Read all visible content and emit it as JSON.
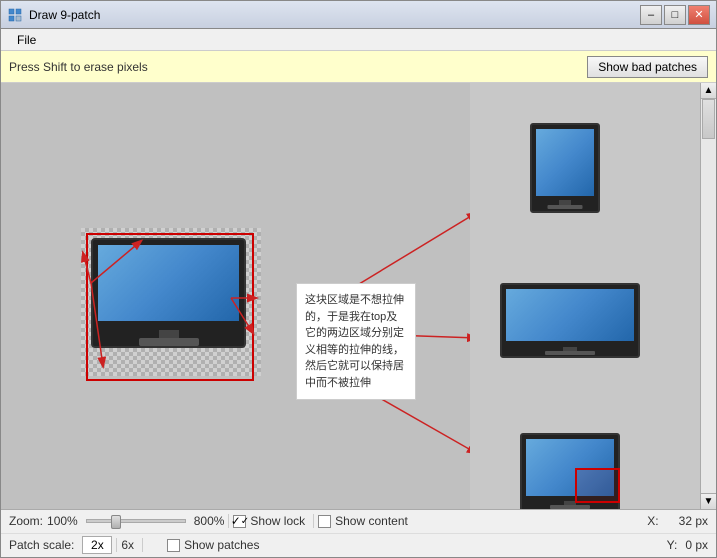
{
  "window": {
    "title": "Draw 9-patch",
    "icon": "patch-icon"
  },
  "window_controls": {
    "minimize": "–",
    "maximize": "□",
    "close": "✕"
  },
  "menu": {
    "file_label": "File"
  },
  "toolbar": {
    "hint": "Press Shift to erase pixels",
    "show_bad_patches": "Show bad patches"
  },
  "tooltip": {
    "text": "这块区域是不想拉伸的，于是我在top及它的两边区域分别定义相等的拉伸的线，然后它就可以保持居中而不被拉伸"
  },
  "status": {
    "zoom_label": "Zoom:",
    "zoom_value": "100%",
    "zoom_max": "800%",
    "show_lock_label": "Show lock",
    "show_content_label": "Show content",
    "show_patches_label": "Show patches",
    "patch_scale_label": "Patch scale:",
    "patch_scale_value": "2x",
    "patch_scale_max": "6x",
    "x_label": "X:",
    "x_value": "32 px",
    "y_label": "Y:",
    "y_value": "0 px"
  },
  "checkboxes": {
    "show_lock_checked": true,
    "show_content_checked": false,
    "show_patches_checked": false
  }
}
